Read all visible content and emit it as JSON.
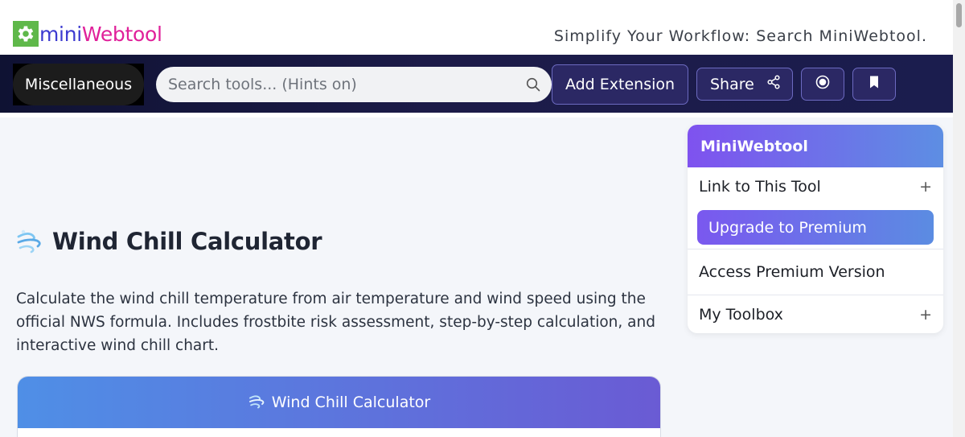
{
  "header": {
    "logo_mini": "mini",
    "logo_webtool": "Webtool",
    "tagline": "Simplify Your Workflow: Search MiniWebtool."
  },
  "nav": {
    "category": "Miscellaneous",
    "search_placeholder": "Search tools... (Hints on)",
    "add_extension": "Add Extension",
    "share": "Share"
  },
  "main": {
    "title": "Wind Chill Calculator",
    "description": "Calculate the wind chill temperature from air temperature and wind speed using the official NWS formula. Includes frostbite risk assessment, step-by-step calculation, and interactive wind chill chart.",
    "card_title": "Wind Chill Calculator"
  },
  "sidebar": {
    "title": "MiniWebtool",
    "link_to_tool": "Link to This Tool",
    "upgrade": "Upgrade to Premium",
    "access_premium": "Access Premium Version",
    "toolbox": "My Toolbox",
    "plus": "+"
  },
  "colors": {
    "logo_green": "#5fb84a",
    "logo_blue": "#3c3ad0",
    "logo_pink": "#e0209a",
    "nav_dark": "#1b1d4e",
    "accent_purple": "#7f52ef",
    "accent_blue": "#5d8ee3"
  }
}
